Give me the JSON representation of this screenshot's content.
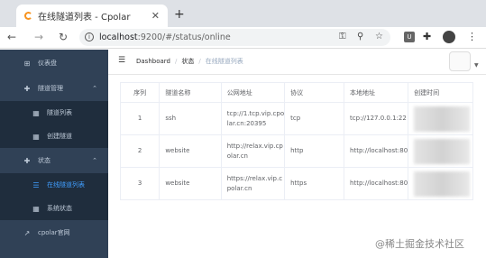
{
  "browser": {
    "tab_title": "在线隧道列表 - Cpolar",
    "tab_close": "✕",
    "new_tab": "+",
    "back": "←",
    "forward": "→",
    "reload": "↻",
    "url_host": "localhost",
    "url_path": ":9200/#/status/online",
    "info_glyph": "i",
    "key_glyph": "⚿",
    "zoom_glyph": "⚲",
    "star_glyph": "☆",
    "ext_u": "U",
    "puzzle_glyph": "✚",
    "menu_glyph": "⋮"
  },
  "sidebar": {
    "items": [
      {
        "label": "仪表盘",
        "icon": "⊞",
        "type": "top"
      },
      {
        "label": "隧道管理",
        "icon": "✚",
        "type": "top",
        "chevron": "⌃"
      },
      {
        "label": "隧道列表",
        "icon": "▦",
        "type": "sub"
      },
      {
        "label": "创建隧道",
        "icon": "▦",
        "type": "sub"
      },
      {
        "label": "状态",
        "icon": "✚",
        "type": "top",
        "chevron": "⌃"
      },
      {
        "label": "在线隧道列表",
        "icon": "☰",
        "type": "sub",
        "active": true
      },
      {
        "label": "系统状态",
        "icon": "▦",
        "type": "sub"
      },
      {
        "label": "cpolar官网",
        "icon": "↗",
        "type": "top"
      }
    ]
  },
  "header": {
    "hamburger": "☰",
    "breadcrumb": [
      "Dashboard",
      "状态",
      "在线隧道列表"
    ],
    "separator": "/",
    "avatar_caret": "▼"
  },
  "table": {
    "columns": [
      "序列",
      "隧道名称",
      "公网地址",
      "协议",
      "本地地址",
      "创建时间"
    ],
    "rows": [
      {
        "index": "1",
        "name": "ssh",
        "public_line1": "tcp://1.tcp.vip.cpo",
        "public_line2": "lar.cn:20395",
        "protocol": "tcp",
        "local": "tcp://127.0.0.1:22"
      },
      {
        "index": "2",
        "name": "website",
        "public_line1": "http://relax.vip.cp",
        "public_line2": "olar.cn",
        "protocol": "http",
        "local": "http://localhost:80"
      },
      {
        "index": "3",
        "name": "website",
        "public_line1": "https://relax.vip.c",
        "public_line2": "polar.cn",
        "protocol": "https",
        "local": "http://localhost:80"
      }
    ]
  },
  "watermark": "@稀土掘金技术社区",
  "colors": {
    "sidebar_bg": "#304156",
    "sidebar_sub_bg": "#1f2d3d",
    "sidebar_text": "#bfcbd9",
    "active": "#409eff"
  }
}
